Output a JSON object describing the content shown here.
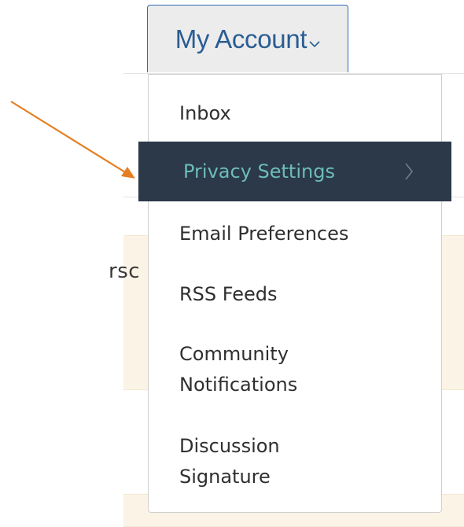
{
  "account_menu": {
    "button_label": "My Account",
    "caret_icon": "chevron-down-icon",
    "items": [
      {
        "label": "Inbox"
      },
      {
        "label": "Privacy Settings",
        "highlighted": true,
        "submenu_icon": "chevron-right-icon"
      },
      {
        "label": "Email Preferences"
      },
      {
        "label": "RSS Feeds"
      },
      {
        "label": "Community Notifications"
      },
      {
        "label": "Discussion Signature"
      }
    ]
  },
  "background": {
    "partial_text": "rsc"
  },
  "annotation": {
    "arrow_icon": "arrow-icon",
    "arrow_color": "#e67e22"
  },
  "colors": {
    "button_text": "#2a5d93",
    "button_border": "#2c6db3",
    "highlight_bg": "#2b3949",
    "highlight_text": "#6dbdb8",
    "menu_text": "#2f2f2f"
  }
}
